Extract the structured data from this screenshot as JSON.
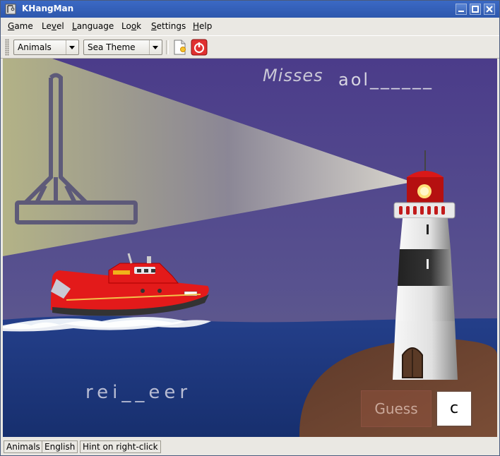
{
  "window": {
    "title": "KHangMan"
  },
  "menu": {
    "items": [
      {
        "label": "Game",
        "mnemonic_index": 0
      },
      {
        "label": "Level",
        "mnemonic_index": 2
      },
      {
        "label": "Language",
        "mnemonic_index": 0
      },
      {
        "label": "Look",
        "mnemonic_index": 2
      },
      {
        "label": "Settings",
        "mnemonic_index": 0
      },
      {
        "label": "Help",
        "mnemonic_index": 0
      }
    ]
  },
  "toolbar": {
    "category_combo": "Animals",
    "theme_combo": "Sea Theme",
    "new_icon": "new-document-icon",
    "quit_icon": "quit-icon"
  },
  "game": {
    "misses_label": "Misses",
    "misses_value": "aol______",
    "word": "rei__eer",
    "guess_label": "Guess",
    "guess_value": "c"
  },
  "status": {
    "category": "Animals",
    "language": "English",
    "hint": "Hint on right-click"
  },
  "colors": {
    "sky_top": "#4b3f8c",
    "sea": "#1d3a82",
    "island": "#6b4330",
    "boat_red": "#e5161b",
    "titlebar": "#3b69c4"
  }
}
